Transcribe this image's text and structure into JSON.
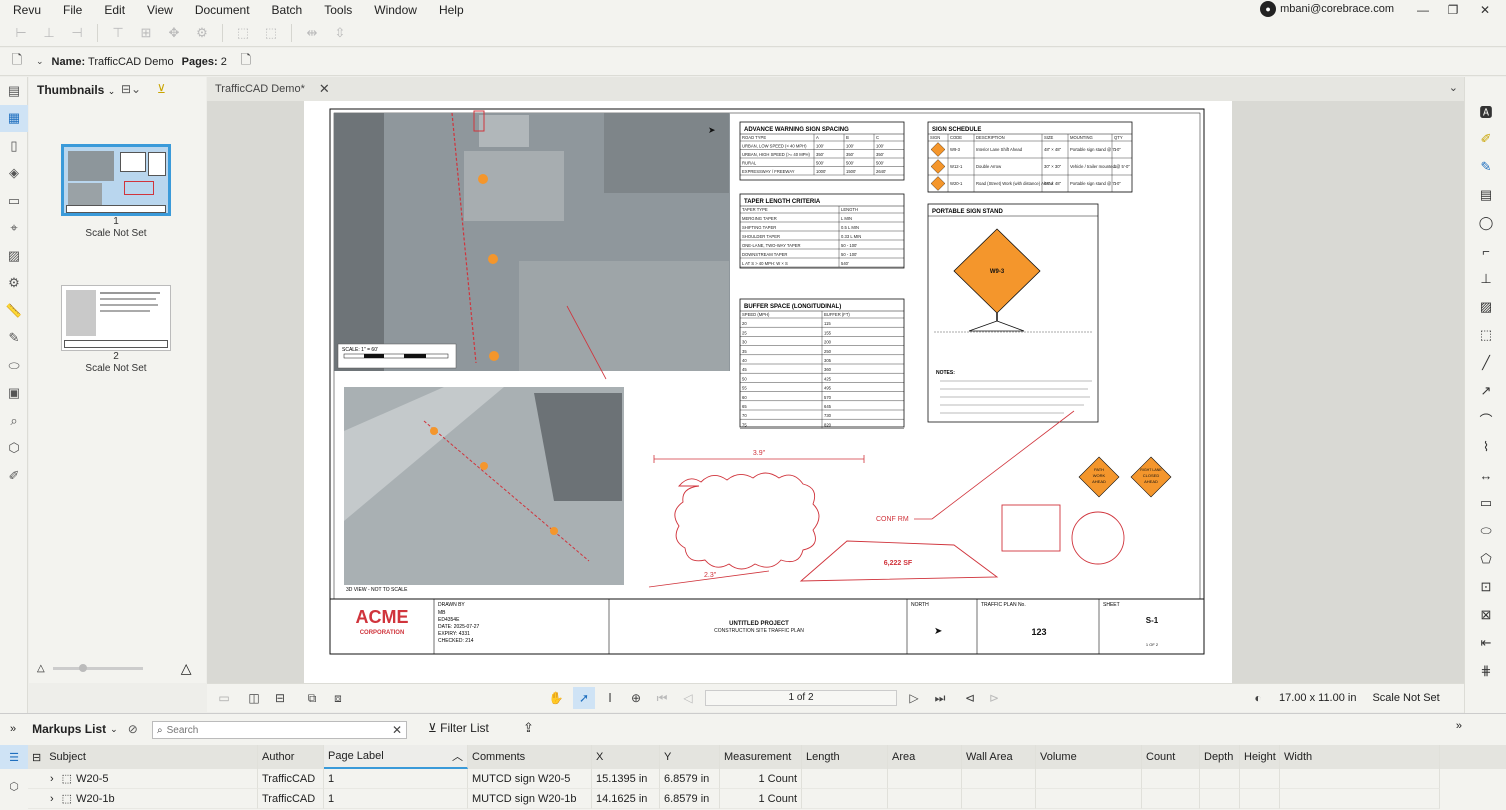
{
  "menu": [
    "Revu",
    "File",
    "Edit",
    "View",
    "Document",
    "Batch",
    "Tools",
    "Window",
    "Help"
  ],
  "account": {
    "email": "mbani@corebrace.com"
  },
  "doc": {
    "name_label": "Name:",
    "name": "TrafficCAD Demo",
    "pages_label": "Pages:",
    "pages": "2",
    "tab_title": "TrafficCAD Demo*"
  },
  "thumbnails": {
    "title": "Thumbnails",
    "items": [
      {
        "num": "1",
        "scale": "Scale Not Set",
        "selected": true
      },
      {
        "num": "2",
        "scale": "Scale Not Set",
        "selected": false
      }
    ]
  },
  "status": {
    "page": "1 of 2",
    "size": "17.00 x 11.00 in",
    "scale": "Scale Not Set"
  },
  "sheet": {
    "advance_title": "ADVANCE WARNING SIGN SPACING",
    "advance_cols": [
      "ROAD TYPE",
      "A",
      "B",
      "C"
    ],
    "advance_rows": [
      [
        "URBAN, LOW SPEED (< 40 MPH)",
        "100'",
        "100'",
        "100'"
      ],
      [
        "URBAN, HIGH SPEED (>= 40 MPH)",
        "350'",
        "350'",
        "350'"
      ],
      [
        "RURAL",
        "500'",
        "500'",
        "500'"
      ],
      [
        "EXPRESSWAY / FREEWAY",
        "1000'",
        "1500'",
        "2640'"
      ]
    ],
    "taper_title": "TAPER LENGTH CRITERIA",
    "taper_cols": [
      "TAPER TYPE",
      "LENGTH"
    ],
    "taper_rows": [
      [
        "MERGING TAPER",
        "L MIN"
      ],
      [
        "SHIFTING TAPER",
        "0.5 L MIN"
      ],
      [
        "SHOULDER TAPER",
        "0.33 L MIN"
      ],
      [
        "ONE-LANE, TWO-WAY TAPER",
        "50 - 100'"
      ],
      [
        "DOWNSTREAM TAPER",
        "50 - 100'"
      ],
      [
        "L AT S > 40 MPH: W × S",
        "540'"
      ]
    ],
    "buffer_title": "BUFFER SPACE (LONGITUDINAL)",
    "buffer_cols": [
      "SPEED (MPH)",
      "BUFFER (FT)"
    ],
    "buffer_rows": [
      [
        "20",
        "115"
      ],
      [
        "25",
        "155"
      ],
      [
        "30",
        "200"
      ],
      [
        "35",
        "250"
      ],
      [
        "40",
        "305"
      ],
      [
        "45",
        "360"
      ],
      [
        "50",
        "425"
      ],
      [
        "55",
        "495"
      ],
      [
        "60",
        "570"
      ],
      [
        "65",
        "645"
      ],
      [
        "70",
        "730"
      ],
      [
        "75",
        "820"
      ]
    ],
    "sign_title": "SIGN SCHEDULE",
    "sign_cols": [
      "SIGN",
      "CODE",
      "DESCRIPTION",
      "SIZE",
      "MOUNTING",
      "QTY"
    ],
    "sign_rows": [
      [
        "W9-3",
        "Interior Lane Shift Ahead",
        "48\" × 48\"",
        "Portable sign stand @ 7'-0\"",
        "1"
      ],
      [
        "W12-1",
        "Double Arrow",
        "30\" × 30\"",
        "Vehicle / trailer mounted @ 5'-0\"",
        "1"
      ],
      [
        "W20-1",
        "Road (Street) Work (with distance) Ahead",
        "48\" × 48\"",
        "Portable sign stand @ 7'-0\"",
        "1"
      ]
    ],
    "stand_title": "PORTABLE SIGN STAND",
    "stand_sign": "W9-3",
    "notes_label": "NOTES:",
    "aerial_scale": "SCALE: 1\" = 60'",
    "view_label": "3D VIEW - NOT TO SCALE",
    "dim_top": "3.9\"",
    "dim_bottom": "2.3\"",
    "conf_rm": "CONF RM",
    "area_sf": "6,222 SF",
    "sign_path": [
      "PATH",
      "WORK",
      "AHEAD"
    ],
    "sign_right": [
      "RIGHT LANE",
      "CLOSED",
      "AHEAD"
    ],
    "title_logo": "ACME",
    "title_logo_sub": "CORPORATION",
    "drawn_info": [
      "DRAWN BY",
      "MB",
      "ED4354E",
      "DATE: 2025-07-27",
      "EXPIRY: 4331",
      "CHECKED: 214"
    ],
    "project_title": "UNTITLED PROJECT",
    "project_sub": "CONSTRUCTION SITE TRAFFIC PLAN",
    "north_label": "NORTH",
    "tcp_label": "TRAFFIC PLAN No.",
    "tcp_num": "123",
    "sheet_label": "SHEET",
    "sheet_num": "S-1",
    "sheet_of": "1 OF 2"
  },
  "markups": {
    "title": "Markups List",
    "search_placeholder": "Search",
    "filter_label": "Filter List",
    "columns": [
      "Subject",
      "Author",
      "Page Label",
      "Comments",
      "X",
      "Y",
      "Measurement",
      "Length",
      "Area",
      "Wall Area",
      "Volume",
      "Count",
      "Depth",
      "Height",
      "Width"
    ],
    "rows": [
      [
        "W20-5",
        "TrafficCAD",
        "1",
        "MUTCD sign W20-5",
        "15.1395 in",
        "6.8579 in",
        "1 Count",
        "",
        "",
        "",
        "",
        "",
        "",
        "",
        ""
      ],
      [
        "W20-1b",
        "TrafficCAD",
        "1",
        "MUTCD sign W20-1b",
        "14.1625 in",
        "6.8579 in",
        "1 Count",
        "",
        "",
        "",
        "",
        "",
        "",
        "",
        ""
      ]
    ]
  },
  "colors": {
    "accent": "#3a9ad9",
    "markup_red": "#d0343c",
    "sign_orange": "#f4962c"
  }
}
